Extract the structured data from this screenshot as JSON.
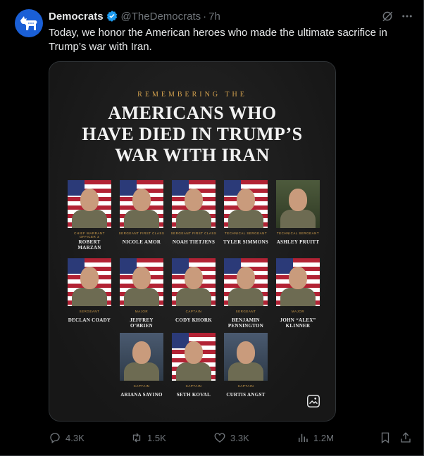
{
  "tweet": {
    "display_name": "Democrats",
    "handle": "@TheDemocrats",
    "separator": "·",
    "time": "7h",
    "text": "Today, we honor the American heroes who made the ultimate sacrifice in Trump’s war with Iran."
  },
  "media": {
    "kicker": "REMEMBERING THE",
    "headline_lines": [
      "AMERICANS WHO",
      "HAVE DIED IN TRUMP’S",
      "WAR WITH IRAN"
    ],
    "people": [
      {
        "rank": "CHIEF WARRANT OFFICER 3",
        "name": "ROBERT MARZAN",
        "bg": "flag"
      },
      {
        "rank": "SERGEANT FIRST CLASS",
        "name": "NICOLE AMOR",
        "bg": "flag"
      },
      {
        "rank": "SERGEANT FIRST CLASS",
        "name": "NOAH TIETJENS",
        "bg": "flag"
      },
      {
        "rank": "TECHNICAL SERGEANT",
        "name": "TYLER SIMMONS",
        "bg": "flag"
      },
      {
        "rank": "TECHNICAL SERGEANT",
        "name": "ASHLEY PRUITT",
        "bg": "green"
      },
      {
        "rank": "SERGEANT",
        "name": "DECLAN COADY",
        "bg": "flag"
      },
      {
        "rank": "MAJOR",
        "name": "JEFFREY O’BRIEN",
        "bg": "flag"
      },
      {
        "rank": "CAPTAIN",
        "name": "CODY KHORK",
        "bg": "flag"
      },
      {
        "rank": "SERGEANT",
        "name": "BENJAMIN PENNINGTON",
        "bg": "flag"
      },
      {
        "rank": "MAJOR",
        "name": "JOHN “ALEX” KLINNER",
        "bg": "flag"
      },
      {
        "rank": "CAPTAIN",
        "name": "ARIANA SAVINO",
        "bg": "plain"
      },
      {
        "rank": "CAPTAIN",
        "name": "SETH KOVAL",
        "bg": "flag"
      },
      {
        "rank": "CAPTAIN",
        "name": "CURTIS ANGST",
        "bg": "plain"
      }
    ]
  },
  "actions": {
    "replies": "4.3K",
    "reposts": "1.5K",
    "likes": "3.3K",
    "views": "1.2M"
  },
  "icons": {
    "avatar": "donkey-logo-icon",
    "verified": "verified-badge-icon",
    "grok": "grok-icon",
    "more": "more-icon",
    "alt": "alt-text-icon",
    "reply": "reply-icon",
    "repost": "repost-icon",
    "like": "heart-icon",
    "views": "views-icon",
    "bookmark": "bookmark-icon",
    "share": "share-icon"
  },
  "colors": {
    "accent_blue": "#1d9bf0",
    "gold": "#d4a24e",
    "muted": "#71767b"
  }
}
